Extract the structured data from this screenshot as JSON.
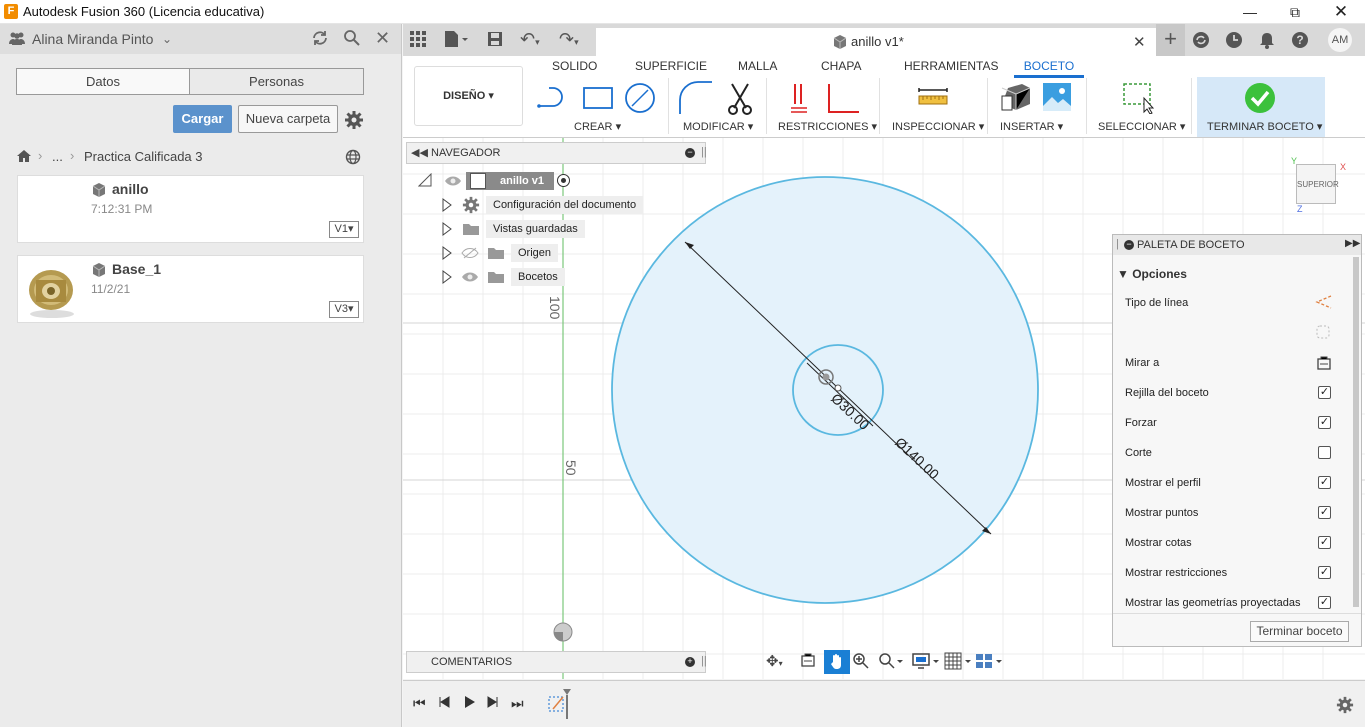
{
  "window": {
    "title": "Autodesk Fusion 360 (Licencia educativa)",
    "logo_letter": "F"
  },
  "user": {
    "name": "Alina Miranda Pinto",
    "initials": "AM"
  },
  "data_panel": {
    "tabs": [
      "Datos",
      "Personas"
    ],
    "upload_label": "Cargar",
    "new_folder_label": "Nueva carpeta",
    "breadcrumb": {
      "ellipsis": "...",
      "folder": "Practica Calificada 3"
    },
    "files": [
      {
        "name": "anillo",
        "date": "7:12:31 PM",
        "version": "V1"
      },
      {
        "name": "Base_1",
        "date": "11/2/21",
        "version": "V3"
      }
    ]
  },
  "document": {
    "tab_label": "anillo v1*"
  },
  "ribbon": {
    "tabs": [
      "SOLIDO",
      "SUPERFICIE",
      "MALLA",
      "CHAPA",
      "HERRAMIENTAS",
      "BOCETO"
    ],
    "active_tab": "BOCETO",
    "workspace": "DISEÑO",
    "groups": [
      "CREAR",
      "MODIFICAR",
      "RESTRICCIONES",
      "INSPECCIONAR",
      "INSERTAR",
      "SELECCIONAR",
      "TERMINAR BOCETO"
    ]
  },
  "navigator": {
    "title": "NAVEGADOR",
    "root": "anillo v1",
    "items": [
      "Configuración del documento",
      "Vistas guardadas",
      "Origen",
      "Bocetos"
    ]
  },
  "comments": {
    "title": "COMENTARIOS"
  },
  "sketch": {
    "ruler_labels": [
      "100",
      "50"
    ],
    "inner_dimension": "Ø30.00",
    "outer_dimension": "Ø140.00"
  },
  "viewcube": {
    "face": "SUPERIOR",
    "axis_x": "X",
    "axis_y": "Y",
    "axis_z": "Z"
  },
  "palette": {
    "title": "PALETA DE BOCETO",
    "section": "Opciones",
    "options": [
      {
        "label": "Tipo de línea",
        "kind": "icon"
      },
      {
        "label": "",
        "kind": "icon"
      },
      {
        "label": "Mirar a",
        "kind": "icon"
      },
      {
        "label": "Rejilla del boceto",
        "kind": "check",
        "checked": true
      },
      {
        "label": "Forzar",
        "kind": "check",
        "checked": true
      },
      {
        "label": "Corte",
        "kind": "check",
        "checked": false
      },
      {
        "label": "Mostrar el perfil",
        "kind": "check",
        "checked": true
      },
      {
        "label": "Mostrar puntos",
        "kind": "check",
        "checked": true
      },
      {
        "label": "Mostrar cotas",
        "kind": "check",
        "checked": true
      },
      {
        "label": "Mostrar restricciones",
        "kind": "check",
        "checked": true
      },
      {
        "label": "Mostrar las geometrías proyectadas",
        "kind": "check",
        "checked": true
      }
    ],
    "finish_label": "Terminar boceto"
  },
  "colors": {
    "accent": "#1a6fcf",
    "sketch_fill": "#e4f2fb",
    "sketch_line": "#5ab8e0",
    "finish_green": "#3cc13c",
    "upload_blue": "#5b92cc"
  }
}
